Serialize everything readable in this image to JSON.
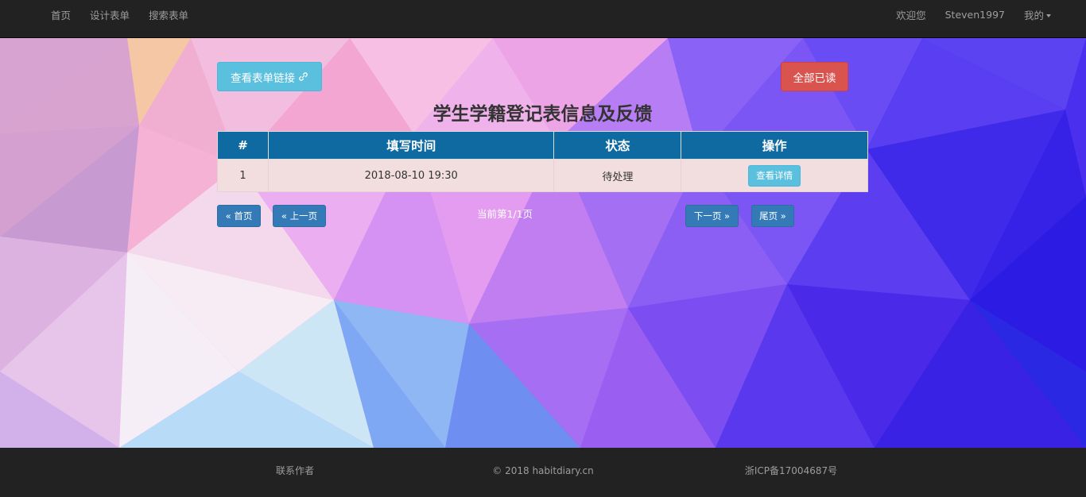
{
  "nav": {
    "left_items": [
      "首页",
      "设计表单",
      "搜索表单"
    ],
    "welcome": "欢迎您",
    "username": "Steven1997",
    "mine_label": "我的"
  },
  "actions": {
    "view_link_label": "查看表单链接",
    "view_link_icon": "link-icon",
    "read_all_label": "全部已读"
  },
  "page_title": "学生学籍登记表信息及反馈",
  "table": {
    "headers": [
      "#",
      "填写时间",
      "状态",
      "操作"
    ],
    "rows": [
      {
        "index": "1",
        "time": "2018-08-10 19:30",
        "status": "待处理",
        "action_label": "查看详情"
      }
    ]
  },
  "pagination": {
    "first": "« 首页",
    "prev": "« 上一页",
    "info": "当前第1/1页",
    "next": "下一页 »",
    "last": "尾页 »"
  },
  "footer": {
    "contact": "联系作者",
    "copyright": "© 2018 habitdiary.cn",
    "icp": "浙ICP备17004687号"
  },
  "colors": {
    "navbar": "#222222",
    "table_header": "#0e6aa0",
    "row_bg": "#f2dede",
    "info_button": "#5bc0de",
    "danger_button": "#d9534f",
    "primary_button": "#337ab7"
  }
}
